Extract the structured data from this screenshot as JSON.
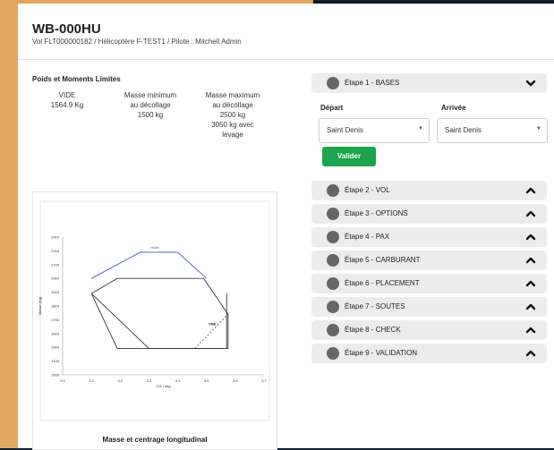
{
  "header": {
    "title": "WB-000HU",
    "subtitle": "Vol FLT000000182 / Hélicoptère F-TEST1 / Pilote : Mitchell Admin"
  },
  "weights": {
    "section_title": "Poids et Moments Limites",
    "empty": {
      "label": "VIDE",
      "value": "1564.9 Kg"
    },
    "min_takeoff": {
      "label_1": "Masse minimum",
      "label_2": "au décollage",
      "value": "1500 kg"
    },
    "max_takeoff": {
      "label_1": "Masse maximum",
      "label_2": "au décollage",
      "value_1": "2500 kg",
      "value_2": "3050 kg avec",
      "value_3": "levage"
    }
  },
  "chart_data": {
    "type": "line",
    "title": "",
    "caption": "Masse et centrage longitudinal",
    "xlabel": "CG Long",
    "ylabel": "Masse (Kg)",
    "x_ticks": [
      "3.0",
      "3.1",
      "3.2",
      "3.3",
      "3.4",
      "3.5",
      "3.6",
      "3.7"
    ],
    "y_ticks": [
      "1000",
      "1100",
      "1500",
      "1600",
      "1700",
      "1800",
      "1900",
      "2000",
      "2100",
      "2200",
      "2300"
    ],
    "annotations": [
      "Hook",
      "VNE"
    ],
    "grid": false,
    "series": [
      {
        "name": "Hook",
        "color": "#3b5bb5",
        "x": [
          3.1,
          3.27,
          3.4,
          3.5
        ],
        "y": [
          2000,
          2190,
          2190,
          2000
        ]
      },
      {
        "color": "#333333",
        "x": [
          3.1,
          3.19,
          3.49,
          3.575,
          3.575,
          3.545,
          3.19,
          3.1
        ],
        "y": [
          1890,
          2000,
          2000,
          1740,
          1465,
          1465,
          1465,
          1890
        ]
      },
      {
        "color": "#333333",
        "x": [
          3.1,
          3.3,
          3.57,
          3.57
        ],
        "y": [
          1890,
          1465,
          1465,
          1890
        ]
      }
    ]
  },
  "steps": {
    "items": [
      {
        "label": "Étape 1 - BASES",
        "expanded": true
      },
      {
        "label": "Étape 2 - VOL"
      },
      {
        "label": "Étape 3 - OPTIONS"
      },
      {
        "label": "Étape 4 - PAX"
      },
      {
        "label": "Étape 5 - CARBURANT"
      },
      {
        "label": "Étape 6 - PLACEMENT"
      },
      {
        "label": "Étape 7 - SOUTES"
      },
      {
        "label": "Étape 8 - CHECK"
      },
      {
        "label": "Étape 9 - VALIDATION"
      }
    ],
    "step1": {
      "departure_label": "Départ",
      "arrival_label": "Arrivée",
      "departure_value": "Saint Denis",
      "arrival_value": "Saint Denis",
      "validate_label": "Valider"
    }
  },
  "colors": {
    "accent_strip": "#e0a85e",
    "validate_green": "#1ea44c",
    "step_dot": "#666666"
  }
}
